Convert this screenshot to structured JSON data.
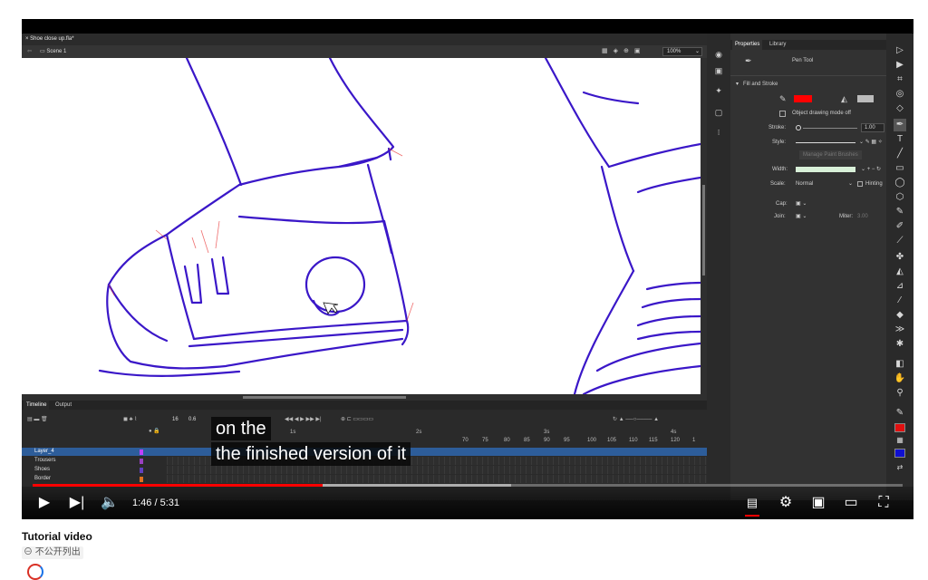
{
  "app": {
    "document_tab": "Shoe close up.fla*",
    "scene": "Scene 1",
    "zoom": "100%"
  },
  "timeline": {
    "tabs": [
      "Timeline",
      "Output"
    ],
    "frame_counter": "16",
    "fps": "0.6",
    "ruler_numbers": [
      "1s",
      "2s",
      "3s",
      "4s",
      "70",
      "75",
      "80",
      "85",
      "90",
      "95",
      "100",
      "105",
      "110",
      "115",
      "120",
      "1"
    ],
    "layers": [
      {
        "name": "Layer_4",
        "color": "#c040ff",
        "selected": true
      },
      {
        "name": "Trousers",
        "color": "#9a40c0",
        "selected": false
      },
      {
        "name": "Shoes",
        "color": "#6040c0",
        "selected": false
      },
      {
        "name": "Border",
        "color": "#e07020",
        "selected": false
      }
    ]
  },
  "properties": {
    "tabs": [
      "Properties",
      "Library"
    ],
    "tool_name": "Pen Tool",
    "section": "Fill and Stroke",
    "stroke_color": "#ff0000",
    "object_drawing": "Object drawing mode off",
    "stroke_label": "Stroke:",
    "stroke_value": "1.00",
    "style_label": "Style:",
    "manage_brushes": "Manage Paint Brushes",
    "width_label": "Width:",
    "scale_label": "Scale:",
    "scale_value": "Normal",
    "hinting": "Hinting",
    "cap_label": "Cap:",
    "join_label": "Join:",
    "miter_label": "Miter:",
    "miter_value": "3.00"
  },
  "player": {
    "caption_line1": "on the",
    "caption_line2": "the finished version of it",
    "time": "1:46 / 5:31",
    "played_fraction": 0.333,
    "loaded_fraction": 0.55,
    "accent": "#ff0000"
  },
  "page": {
    "video_title": "Tutorial video",
    "visibility": "不公开列出"
  }
}
